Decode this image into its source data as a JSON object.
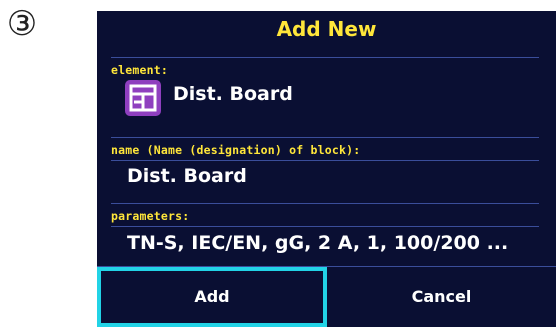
{
  "step_marker": "③",
  "dialog": {
    "title": "Add New",
    "element": {
      "label": "element:",
      "value": "Dist. Board",
      "icon": "distribution-board-icon"
    },
    "name": {
      "label": "name (Name (designation) of block):",
      "value": "Dist. Board"
    },
    "parameters": {
      "label": "parameters:",
      "value": "TN-S, IEC/EN, gG, 2 A, 1, 100/200 ..."
    },
    "buttons": {
      "add": "Add",
      "cancel": "Cancel"
    }
  },
  "colors": {
    "background": "#0a0f33",
    "label": "#ffe63a",
    "value": "#ffffff",
    "separator": "#3a4d9a",
    "focus": "#22d3e6",
    "icon_bg": "#8f3fbf"
  }
}
